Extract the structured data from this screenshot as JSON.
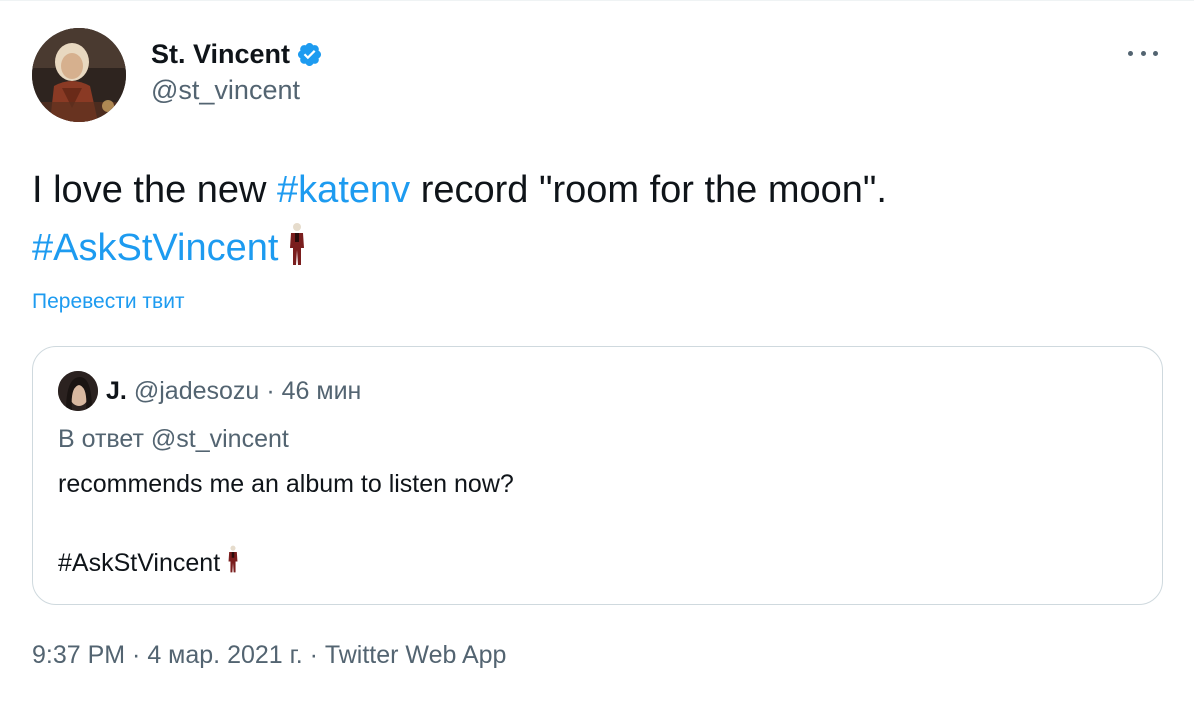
{
  "author": {
    "name": "St. Vincent",
    "handle": "@st_vincent",
    "verified_icon": "verified-badge-icon",
    "verified_color": "#1d9bf0"
  },
  "more_icon": "more-dots-icon",
  "tweet": {
    "text_part1": "I love the new ",
    "hashtag1": "#katenv",
    "text_part2": " record \"room for the moon\".",
    "hashtag2": "#AskStVincent",
    "emoji": "suited-figure-emoji"
  },
  "translate_label": "Перевести твит",
  "quoted_tweet": {
    "name": "J.",
    "handle": "@jadesozu",
    "separator": "·",
    "time": "46 мин",
    "reply_to": "В ответ @st_vincent",
    "body_line1": "recommends me an album to listen now?",
    "body_line2": "#AskStVincent",
    "emoji": "suited-figure-emoji"
  },
  "footer": {
    "time": "9:37 PM",
    "sep1": " · ",
    "date": "4 мар. 2021 г.",
    "sep2": " · ",
    "source": "Twitter Web App"
  },
  "colors": {
    "link": "#1d9bf0",
    "muted": "#536471",
    "text": "#0f1419",
    "border": "#cfd9de"
  }
}
